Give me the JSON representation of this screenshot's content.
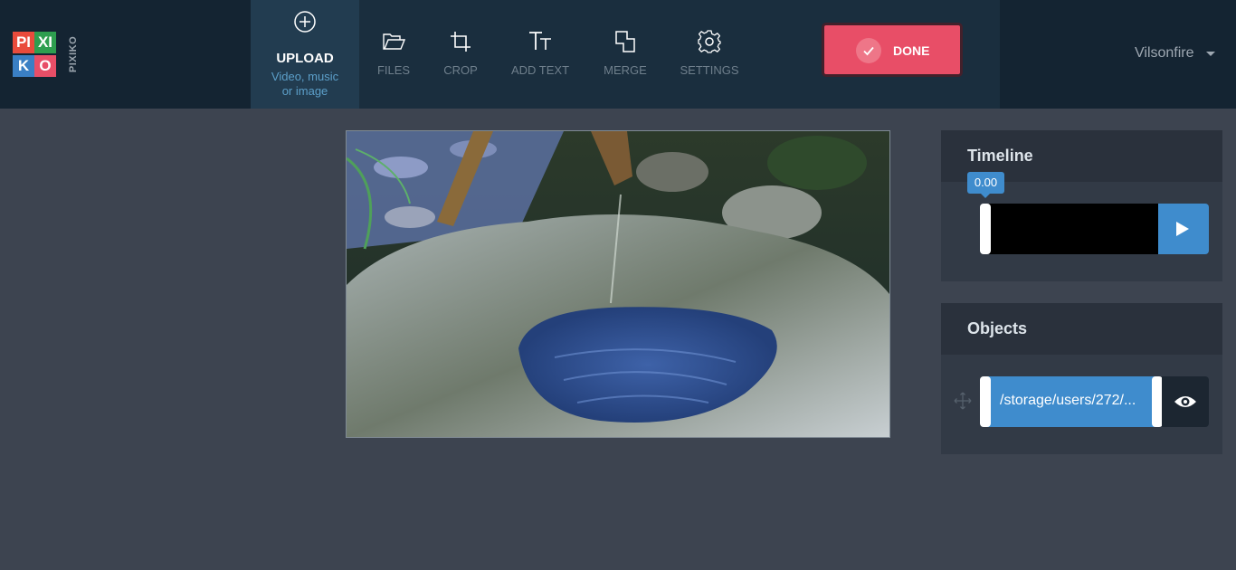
{
  "logo": {
    "cells": [
      "PI",
      "XI",
      "KO"
    ],
    "side_text": "PIXIKO",
    "colors": [
      "#e94b3c",
      "#2e9e4f",
      "#3a7fc4",
      "#e84e67"
    ]
  },
  "toolbar": {
    "upload": {
      "title": "UPLOAD",
      "subtitle_line1": "Video, music",
      "subtitle_line2": "or image"
    },
    "files_label": "FILES",
    "crop_label": "CROP",
    "add_text_label": "ADD TEXT",
    "merge_label": "MERGE",
    "settings_label": "SETTINGS",
    "done_label": "DONE"
  },
  "user": {
    "name": "Vilsonfire"
  },
  "timeline": {
    "title": "Timeline",
    "time": "0.00"
  },
  "objects": {
    "title": "Objects",
    "item_label": "/storage/users/272/..."
  },
  "colors": {
    "accent": "#3f8ccd",
    "done": "#e84e67",
    "topbar": "#142432",
    "background": "#3d4450"
  }
}
